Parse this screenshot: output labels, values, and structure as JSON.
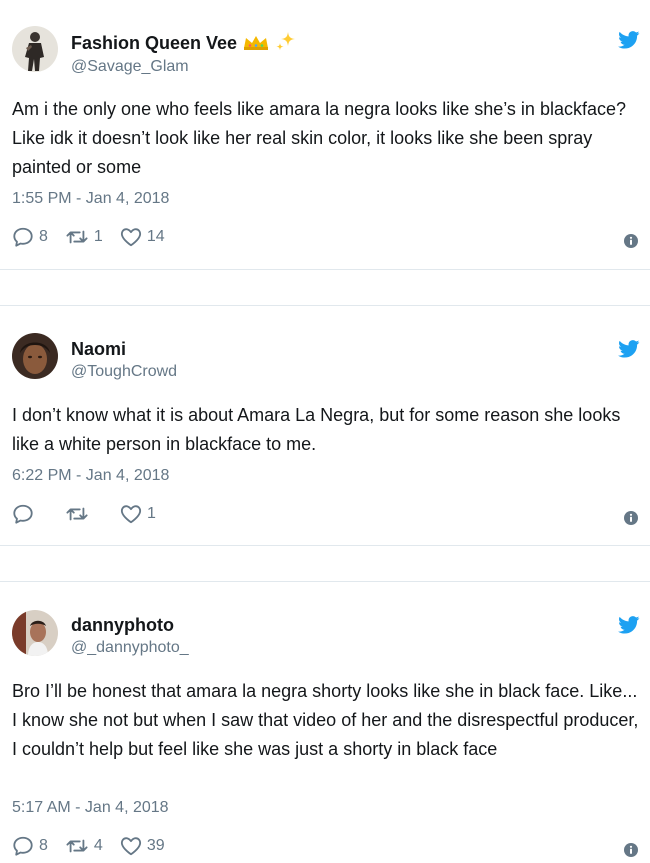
{
  "tweets": [
    {
      "name": "Fashion Queen Vee",
      "name_emoji": [
        "crown-emoji",
        "sparkles-emoji"
      ],
      "handle": "@Savage_Glam",
      "text": "Am i the only one who feels like amara la negra looks like she’s in blackface? Like idk it doesn’t look like her real skin color, it looks like she been spray painted or some",
      "timestamp": "1:55 PM - Jan 4, 2018",
      "replies": "8",
      "retweets": "1",
      "likes": "14"
    },
    {
      "name": "Naomi",
      "handle": "@ToughCrowd",
      "text": "I don’t know what it is about Amara La Negra, but for some reason she looks like a white person in blackface to me.",
      "timestamp": "6:22 PM - Jan 4, 2018",
      "replies": "",
      "retweets": "",
      "likes": "1"
    },
    {
      "name": "dannyphoto",
      "handle": "@_dannyphoto_",
      "text": "Bro I’ll be honest that amara la negra shorty looks like she in black face. Like... I know she not but when I saw that video of her and the disrespectful producer, I couldn’t help but feel like she was just a shorty in black face",
      "timestamp": "5:17 AM - Jan 4, 2018",
      "replies": "8",
      "retweets": "4",
      "likes": "39"
    }
  ],
  "icons": {
    "platform": "twitter-bird-icon",
    "reply": "reply-icon",
    "retweet": "retweet-icon",
    "like": "heart-icon",
    "info": "info-icon"
  },
  "colors": {
    "accent": "#1da1f2",
    "muted": "#657786",
    "text": "#14171a",
    "separator": "#e1e8ed",
    "crown": "#f5b800",
    "sparkles": "#ffcc33"
  }
}
